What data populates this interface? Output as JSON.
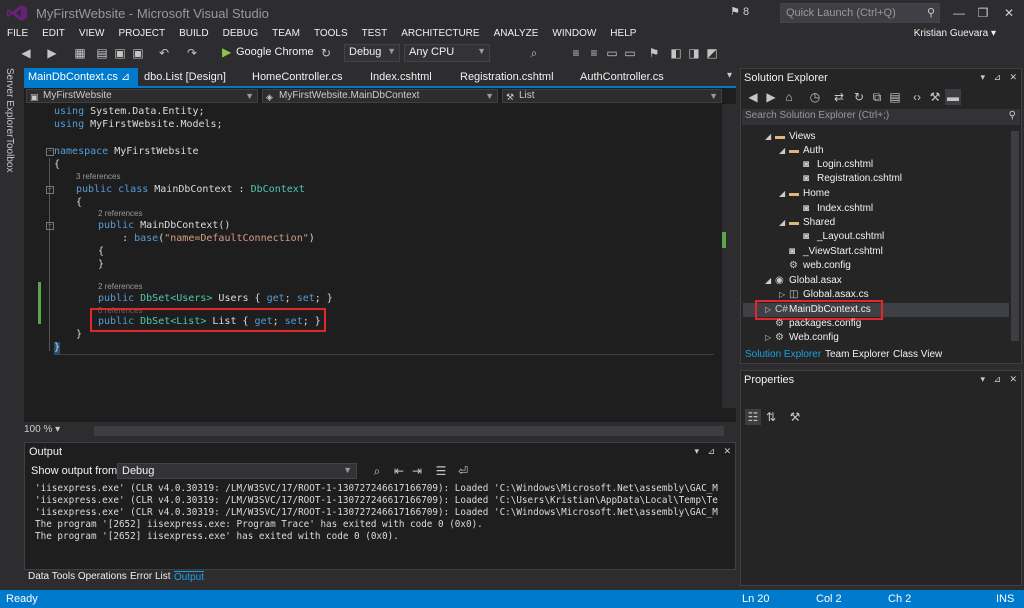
{
  "window": {
    "title": "MyFirstWebsite - Microsoft Visual Studio",
    "notification_count": "8",
    "quick_launch_placeholder": "Quick Launch (Ctrl+Q)"
  },
  "menu": [
    "FILE",
    "EDIT",
    "VIEW",
    "PROJECT",
    "BUILD",
    "DEBUG",
    "TEAM",
    "TOOLS",
    "TEST",
    "ARCHITECTURE",
    "ANALYZE",
    "WINDOW",
    "HELP"
  ],
  "user": {
    "name": "Kristian Guevara"
  },
  "toolbar": {
    "run_target": "Google Chrome",
    "config": "Debug",
    "platform": "Any CPU"
  },
  "side_tabs": [
    "Server Explorer",
    "Toolbox"
  ],
  "editor": {
    "tabs": [
      {
        "label": "MainDbContext.cs",
        "active": true
      },
      {
        "label": "dbo.List [Design]"
      },
      {
        "label": "HomeController.cs"
      },
      {
        "label": "Index.cshtml"
      },
      {
        "label": "Registration.cshtml"
      },
      {
        "label": "AuthController.cs"
      }
    ],
    "nav_project": "MyFirstWebsite",
    "nav_class": "MyFirstWebsite.MainDbContext",
    "nav_member": "List",
    "zoom": "100 %",
    "code": {
      "l1_kw": "using",
      "l1_rest": " System.Data.Entity;",
      "l2_kw": "using",
      "l2_rest": " MyFirstWebsite.Models;",
      "l3_kw": "namespace",
      "l3_rest": " MyFirstWebsite",
      "brace_open": "{",
      "brace_close": "}",
      "ref3": "3 references",
      "l5_kw": "public class",
      "l5_name": " MainDbContext : ",
      "l5_base": "DbContext",
      "ref2a": "2 references",
      "l7_kw": "public",
      "l7_rest": " MainDbContext()",
      "l8_pre": "    : ",
      "l8_kw": "base",
      "l8_open": "(",
      "l8_str": "\"name=DefaultConnection\"",
      "l8_close": ")",
      "ref2b": "2 references",
      "users_kw": "public",
      "users_type": " DbSet<Users>",
      "users_name": " Users { ",
      "users_get": "get",
      "users_mid": "; ",
      "users_set": "set",
      "users_end": "; }",
      "ref_over": "0 references",
      "list_kw": "public",
      "list_type": " DbSet<List>",
      "list_name": " List { ",
      "list_get": "get",
      "list_mid": "; ",
      "list_set": "set",
      "list_end": "; }"
    }
  },
  "output": {
    "title": "Output",
    "show_from_label": "Show output from:",
    "show_from_value": "Debug",
    "lines": [
      "'iisexpress.exe' (CLR v4.0.30319: /LM/W3SVC/17/ROOT-1-130727246617166709): Loaded 'C:\\Windows\\Microsoft.Net\\assembly\\GAC_M",
      "'iisexpress.exe' (CLR v4.0.30319: /LM/W3SVC/17/ROOT-1-130727246617166709): Loaded 'C:\\Users\\Kristian\\AppData\\Local\\Temp\\Te",
      "'iisexpress.exe' (CLR v4.0.30319: /LM/W3SVC/17/ROOT-1-130727246617166709): Loaded 'C:\\Windows\\Microsoft.Net\\assembly\\GAC_M",
      "The program '[2652] iisexpress.exe: Program Trace' has exited with code 0 (0x0).",
      "The program '[2652] iisexpress.exe' has exited with code 0 (0x0)."
    ]
  },
  "bottom_tabs": [
    "Data Tools Operations",
    "Error List",
    "Output"
  ],
  "solution_explorer": {
    "title": "Solution Explorer",
    "search_placeholder": "Search Solution Explorer (Ctrl+;)",
    "items": [
      {
        "label": "Views",
        "kind": "folder"
      },
      {
        "label": "Auth",
        "kind": "folder"
      },
      {
        "label": "Login.cshtml",
        "kind": "file"
      },
      {
        "label": "Registration.cshtml",
        "kind": "file"
      },
      {
        "label": "Home",
        "kind": "folder"
      },
      {
        "label": "Index.cshtml",
        "kind": "file"
      },
      {
        "label": "Shared",
        "kind": "folder"
      },
      {
        "label": "_Layout.cshtml",
        "kind": "file"
      },
      {
        "label": "_ViewStart.cshtml",
        "kind": "file"
      },
      {
        "label": "web.config",
        "kind": "file"
      },
      {
        "label": "Global.asax",
        "kind": "file"
      },
      {
        "label": "Global.asax.cs",
        "kind": "file"
      },
      {
        "label": "MainDbContext.cs",
        "kind": "file",
        "selected": true
      },
      {
        "label": "packages.config",
        "kind": "file"
      },
      {
        "label": "Web.config",
        "kind": "file"
      }
    ],
    "tabs": [
      "Solution Explorer",
      "Team Explorer",
      "Class View"
    ]
  },
  "properties": {
    "title": "Properties"
  },
  "status": {
    "state": "Ready",
    "line": "Ln 20",
    "col": "Col 2",
    "ch": "Ch 2",
    "mode": "INS"
  },
  "colors": {
    "accent": "#007acc",
    "highlight_box": "#e0282c",
    "keyword": "#569cd6",
    "type": "#4ec9b0",
    "string": "#d69d85"
  }
}
